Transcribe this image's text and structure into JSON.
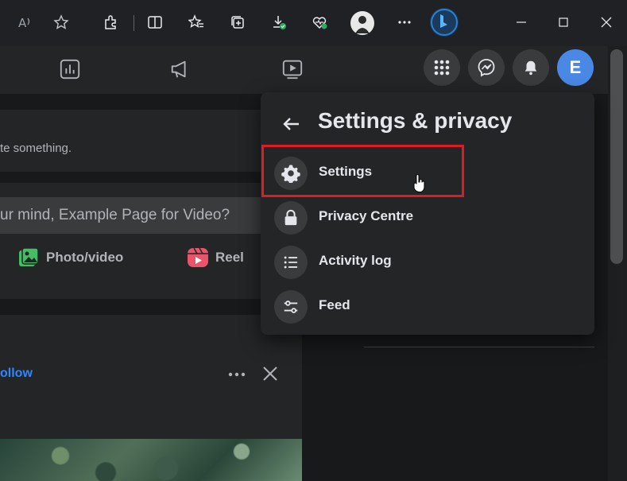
{
  "browser": {
    "icons": [
      "read-aloud-icon",
      "favorite-star-icon",
      "extensions-icon",
      "split-screen-icon",
      "favorites-icon",
      "collections-icon",
      "downloads-icon",
      "browser-essentials-icon",
      "profile-icon",
      "more-icon",
      "bing-copilot-icon",
      "minimize-icon",
      "maximize-icon",
      "close-icon"
    ]
  },
  "nav": {
    "icons": [
      "insights-icon",
      "ads-megaphone-icon",
      "video-icon",
      "menu-grid-icon",
      "messenger-icon",
      "notifications-icon"
    ],
    "avatar_letter": "E"
  },
  "left": {
    "create_hint": "te something.",
    "composer_placeholder": "ur mind, Example Page for Video?",
    "photo_video_label": "Photo/video",
    "reel_label": "Reel",
    "follow_label": "ollow"
  },
  "menu": {
    "title": "Settings & privacy",
    "items": [
      {
        "label": "Settings",
        "icon": "gear-icon"
      },
      {
        "label": "Privacy Centre",
        "icon": "lock-icon"
      },
      {
        "label": "Activity log",
        "icon": "list-icon"
      },
      {
        "label": "Feed",
        "icon": "sliders-icon"
      }
    ]
  },
  "colors": {
    "highlight": "#e01b24",
    "accent": "#4a88e6",
    "follow": "#2d88ff"
  }
}
